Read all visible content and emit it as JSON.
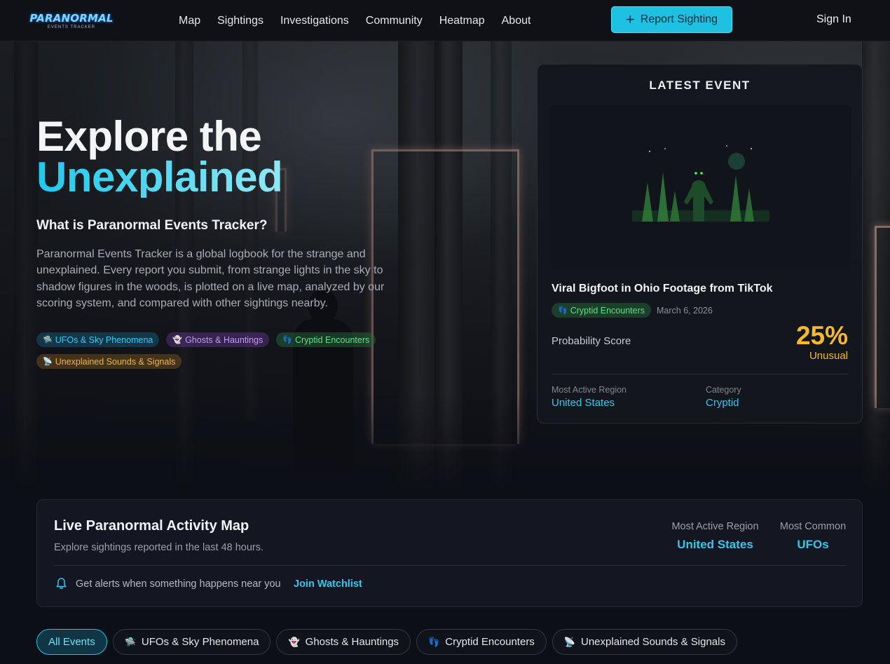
{
  "brand": {
    "logo_main": "PARANORMAL",
    "logo_sub": "EVENTS TRACKER"
  },
  "nav": {
    "links": [
      "Map",
      "Sightings",
      "Investigations",
      "Community",
      "Heatmap",
      "About"
    ],
    "report_button": "Report Sighting",
    "sign_in": "Sign In"
  },
  "hero": {
    "title_line1": "Explore the",
    "title_line2": "Unexplained",
    "subtitle": "What is Paranormal Events Tracker?",
    "description": "Paranormal Events Tracker is a global logbook for the strange and unexplained. Every report you submit, from strange lights in the sky to shadow figures in the woods, is plotted on a live map, analyzed by our scoring system, and compared with other sightings nearby.",
    "tags": [
      {
        "label": "UFOs & Sky Phenomena",
        "icon": "ufo-icon"
      },
      {
        "label": "Ghosts & Hauntings",
        "icon": "ghost-icon"
      },
      {
        "label": "Cryptid Encounters",
        "icon": "footprint-icon"
      },
      {
        "label": "Unexplained Sounds & Signals",
        "icon": "satellite-icon"
      }
    ]
  },
  "latest_event": {
    "heading": "LATEST EVENT",
    "title": "Viral Bigfoot in Ohio Footage from TikTok",
    "tag": "Cryptid Encounters",
    "date": "March 6, 2026",
    "probability_label": "Probability Score",
    "probability_value": "25%",
    "probability_word": "Unusual",
    "region_label": "Most Active Region",
    "region_value": "United States",
    "category_label": "Category",
    "category_value": "Cryptid",
    "accent_color": "#f5b92c"
  },
  "activity_map": {
    "title": "Live Paranormal Activity Map",
    "subtitle": "Explore sightings reported in the last 48 hours.",
    "stat1_label": "Most Active Region",
    "stat1_value": "United States",
    "stat2_label": "Most Common",
    "stat2_value": "UFOs",
    "alert_text": "Get alerts when something happens near you",
    "watchlist_link": "Join Watchlist"
  },
  "filters": {
    "all": "All Events",
    "items": [
      "UFOs & Sky Phenomena",
      "Ghosts & Hauntings",
      "Cryptid Encounters",
      "Unexplained Sounds & Signals"
    ]
  },
  "colors": {
    "accent": "#1ec1e2",
    "background": "#0d0f16"
  }
}
